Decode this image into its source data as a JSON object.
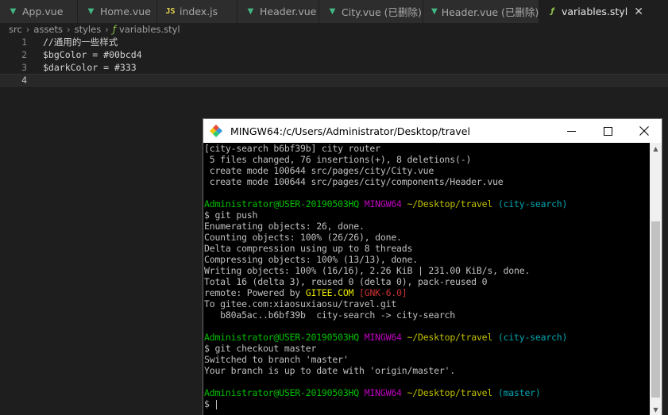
{
  "tabs": [
    {
      "label": "App.vue",
      "icon": "vue-icon"
    },
    {
      "label": "Home.vue",
      "icon": "vue-icon"
    },
    {
      "label": "index.js",
      "icon": "js-icon"
    },
    {
      "label": "Header.vue",
      "icon": "vue-icon"
    },
    {
      "label": "City.vue (已删除)",
      "icon": "vue-icon"
    },
    {
      "label": "Header.vue (已删除)",
      "icon": "vue-icon"
    },
    {
      "label": "variables.styl",
      "icon": "stylus-icon",
      "active": true
    }
  ],
  "breadcrumb": [
    "src",
    "assets",
    "styles",
    "variables.styl"
  ],
  "editor": {
    "lines": [
      {
        "num": "1",
        "text": "//通用的一些样式"
      },
      {
        "num": "2",
        "text": "$bgColor = #00bcd4"
      },
      {
        "num": "3",
        "text": "$darkColor = #333"
      },
      {
        "num": "4",
        "text": ""
      }
    ]
  },
  "terminal": {
    "title": "MINGW64:/c/Users/Administrator/Desktop/travel",
    "lines": {
      "l1": "[city-search b6bf39b] city router",
      "l2": " 5 files changed, 76 insertions(+), 8 deletions(-)",
      "l3": " create mode 100644 src/pages/city/City.vue",
      "l4": " create mode 100644 src/pages/city/components/Header.vue",
      "p1_user": "Administrator@USER-20190503HQ",
      "p1_sys": "MINGW64",
      "p1_path": "~/Desktop/travel",
      "p1_branch": "(city-search)",
      "c1": "$ git push",
      "o1": "Enumerating objects: 26, done.",
      "o2": "Counting objects: 100% (26/26), done.",
      "o3": "Delta compression using up to 8 threads",
      "o4": "Compressing objects: 100% (13/13), done.",
      "o5": "Writing objects: 100% (16/16), 2.26 KiB | 231.00 KiB/s, done.",
      "o6": "Total 16 (delta 3), reused 0 (delta 0), pack-reused 0",
      "o7_pre": "remote: Powered by ",
      "o7_gitee": "GITEE.COM",
      "o7_gnk": "[GNK-6.0]",
      "o8": "To gitee.com:xiaosuxiaosu/travel.git",
      "o9": "   b80a5ac..b6bf39b  city-search -> city-search",
      "p2_user": "Administrator@USER-20190503HQ",
      "p2_sys": "MINGW64",
      "p2_path": "~/Desktop/travel",
      "p2_branch": "(city-search)",
      "c2": "$ git checkout master",
      "o10": "Switched to branch 'master'",
      "o11": "Your branch is up to date with 'origin/master'.",
      "p3_user": "Administrator@USER-20190503HQ",
      "p3_sys": "MINGW64",
      "p3_path": "~/Desktop/travel",
      "p3_branch": "(master)",
      "prompt": "$ "
    }
  }
}
